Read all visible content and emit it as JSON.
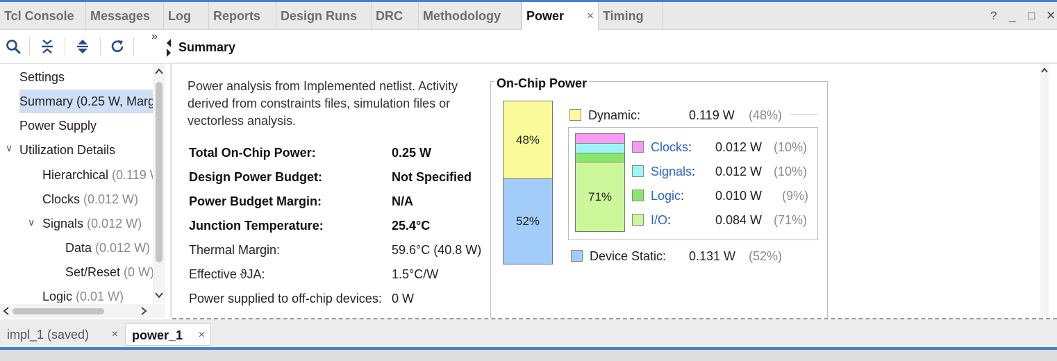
{
  "tabs": [
    {
      "label": "Tcl Console"
    },
    {
      "label": "Messages"
    },
    {
      "label": "Log"
    },
    {
      "label": "Reports"
    },
    {
      "label": "Design Runs"
    },
    {
      "label": "DRC"
    },
    {
      "label": "Methodology"
    },
    {
      "label": "Power",
      "active": true
    },
    {
      "label": "Timing"
    }
  ],
  "window_controls": {
    "help": "?",
    "minimize": "_",
    "maximize": "□",
    "close": "✕"
  },
  "tab_close": "×",
  "toolbar": {
    "overflow": "»",
    "icons": [
      "search-icon",
      "collapse-all-icon",
      "expand-all-icon",
      "refresh-icon"
    ]
  },
  "header": {
    "title": "Summary"
  },
  "tree": [
    {
      "label": "Settings",
      "suffix": ""
    },
    {
      "label": "Summary (0.25 W, Marg",
      "suffix": "",
      "selected": true
    },
    {
      "label": "Power Supply",
      "suffix": ""
    },
    {
      "label": "Utilization Details",
      "suffix": "",
      "expander": "∨"
    },
    {
      "label": "Hierarchical",
      "suffix": " (0.119 W"
    },
    {
      "label": "Clocks",
      "suffix": " (0.012 W)"
    },
    {
      "label": "Signals",
      "suffix": " (0.012 W)",
      "expander": "∨"
    },
    {
      "label": "Data",
      "suffix": " (0.012 W)"
    },
    {
      "label": "Set/Reset",
      "suffix": " (0 W)"
    },
    {
      "label": "Logic",
      "suffix": " (0.01 W)"
    }
  ],
  "summary": {
    "description": "Power analysis from Implemented netlist. Activity derived from constraints files, simulation files or vectorless analysis.",
    "rows": [
      {
        "label": "Total On-Chip Power:",
        "value": "0.25 W",
        "bold": true
      },
      {
        "label": "Design Power Budget:",
        "value": "Not Specified",
        "bold": true
      },
      {
        "label": "Power Budget Margin:",
        "value": "N/A",
        "bold": true
      },
      {
        "label": "Junction Temperature:",
        "value": "25.4°C",
        "bold": true
      },
      {
        "label": "Thermal Margin:",
        "value": "59.6°C (40.8 W)",
        "bold": false
      },
      {
        "label": "Effective ϑJA:",
        "value": "1.5°C/W",
        "bold": false
      },
      {
        "label": "Power supplied to off-chip devices:",
        "value": "0 W",
        "bold": false
      }
    ]
  },
  "on_chip": {
    "title": "On-Chip Power",
    "dynamic": {
      "label": "Dynamic:",
      "value": "0.119 W",
      "pct": "(48%)",
      "share": 48,
      "color": "#fafa9b"
    },
    "static": {
      "label": "Device Static:",
      "value": "0.131 W",
      "pct": "(52%)",
      "share": 52,
      "color": "#a2cdfb"
    },
    "bar_labels": {
      "dynamic": "48%",
      "static": "52%",
      "io": "71%"
    },
    "components": [
      {
        "label": "Clocks",
        "value": "0.012 W",
        "pct": "(10%)",
        "share": 10,
        "color": "#f79cf5"
      },
      {
        "label": "Signals",
        "value": "0.012 W",
        "pct": "(10%)",
        "share": 10,
        "color": "#9ef7f7"
      },
      {
        "label": "Logic",
        "value": "0.010 W",
        "pct": "(9%)",
        "share": 9,
        "color": "#8be66e"
      },
      {
        "label": "I/O",
        "value": "0.084 W",
        "pct": "(71%)",
        "share": 71,
        "color": "#ccf79a"
      }
    ]
  },
  "bottom_tabs": [
    {
      "label": "impl_1 (saved)"
    },
    {
      "label": "power_1",
      "active": true
    }
  ]
}
